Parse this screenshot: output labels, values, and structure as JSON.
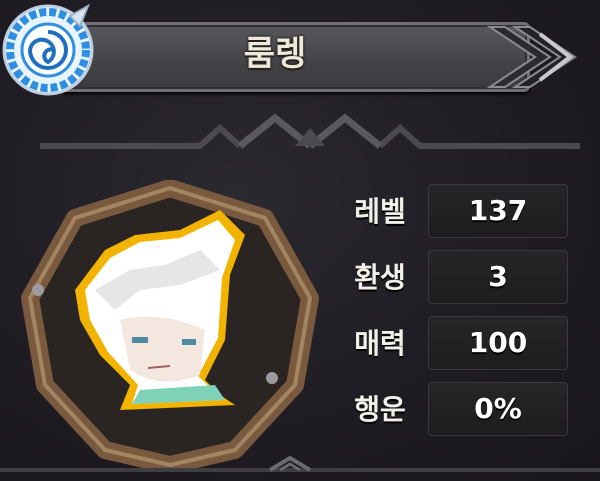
{
  "title": "룸렝",
  "emblem_icon": "blue-swirl-emblem-icon",
  "portrait_icon": "white-haired-character-portrait",
  "stats": [
    {
      "label": "레벨",
      "value": "137"
    },
    {
      "label": "환생",
      "value": "3"
    },
    {
      "label": "매력",
      "value": "100"
    },
    {
      "label": "행운",
      "value": "0%"
    }
  ],
  "colors": {
    "background": "#1f1d23",
    "banner": "#4a4a4e",
    "frame": "#8a6a4a",
    "emblem": "#2f8ee0",
    "portrait_outline": "#f2b400"
  }
}
